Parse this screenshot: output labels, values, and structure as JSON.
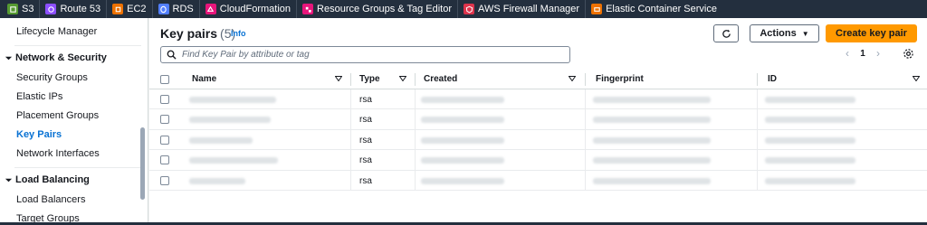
{
  "favorites": [
    {
      "label": "S3",
      "color": "#569a31",
      "icon": "s3-icon"
    },
    {
      "label": "Route 53",
      "color": "#8c4fff",
      "icon": "route53-icon"
    },
    {
      "label": "EC2",
      "color": "#ed7100",
      "icon": "ec2-icon"
    },
    {
      "label": "RDS",
      "color": "#527fff",
      "icon": "rds-icon"
    },
    {
      "label": "CloudFormation",
      "color": "#e7157b",
      "icon": "cloudformation-icon"
    },
    {
      "label": "Resource Groups & Tag Editor",
      "color": "#e7157b",
      "icon": "resource-groups-icon"
    },
    {
      "label": "AWS Firewall Manager",
      "color": "#dd344c",
      "icon": "firewall-manager-icon"
    },
    {
      "label": "Elastic Container Service",
      "color": "#ed7100",
      "icon": "ecs-icon"
    }
  ],
  "sidebar": {
    "lifecycle": "Lifecycle Manager",
    "network_section": "Network & Security",
    "network_items": [
      "Security Groups",
      "Elastic IPs",
      "Placement Groups",
      "Key Pairs",
      "Network Interfaces"
    ],
    "active_item": "Key Pairs",
    "lb_section": "Load Balancing",
    "lb_items": [
      "Load Balancers",
      "Target Groups"
    ]
  },
  "header": {
    "title": "Key pairs",
    "count": "(5)",
    "info": "Info",
    "actions_label": "Actions",
    "create_label": "Create key pair"
  },
  "search": {
    "placeholder": "Find Key Pair by attribute or tag"
  },
  "pagination": {
    "page": "1"
  },
  "table": {
    "columns": [
      "Name",
      "Type",
      "Created",
      "Fingerprint",
      "ID"
    ],
    "rows": [
      {
        "type": "rsa"
      },
      {
        "type": "rsa"
      },
      {
        "type": "rsa"
      },
      {
        "type": "rsa"
      },
      {
        "type": "rsa"
      }
    ]
  },
  "colors": {
    "accent": "#0972d3",
    "primary_button": "#ff9900",
    "topbar": "#232f3e"
  }
}
